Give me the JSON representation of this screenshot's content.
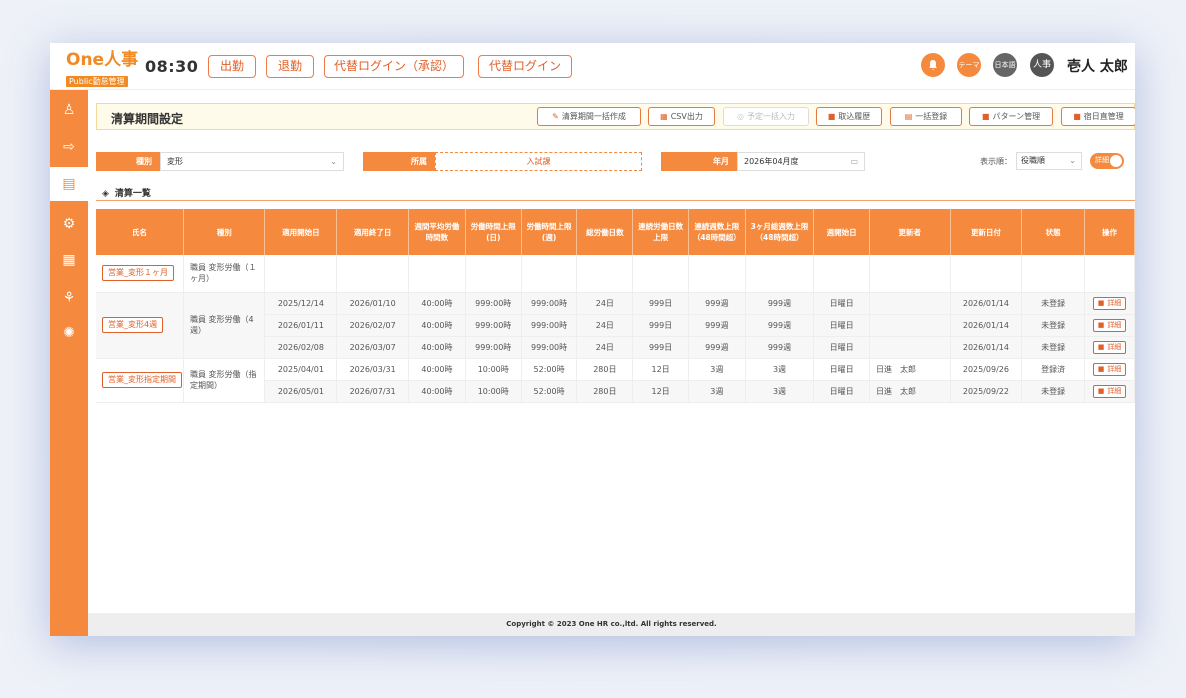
{
  "header": {
    "logo_main": "One人事",
    "logo_sub": "Public勤怠管理",
    "clock": "08:30",
    "buttons": [
      "出勤",
      "退勤",
      "代替ログイン（承認）",
      "代替ログイン"
    ],
    "bell_icon": "bell-icon",
    "theme_label": "テーマ",
    "lang_label": "日本語",
    "avatar_label": "人事",
    "user_name": "壱人 太郎",
    "accent_color": "#f58a3e"
  },
  "sidebar": {
    "icons": [
      "user-icon",
      "clock-in-icon",
      "document-icon",
      "settings-icon",
      "apps-icon",
      "network-icon",
      "atom-icon"
    ],
    "active_index": 2
  },
  "page": {
    "title": "清算期間設定",
    "toolbar": [
      {
        "icon": "✎",
        "label": "清算期間一括作成",
        "disabled": false
      },
      {
        "icon": "▦",
        "label": "CSV出力",
        "disabled": false
      },
      {
        "icon": "◎",
        "label": "予定一括入力",
        "disabled": true
      },
      {
        "icon": "■",
        "label": "取込履歴",
        "disabled": false
      },
      {
        "icon": "▤",
        "label": "一括登録",
        "disabled": false
      },
      {
        "icon": "■",
        "label": "パターン管理",
        "disabled": false
      },
      {
        "icon": "■",
        "label": "宿日直管理",
        "disabled": false
      }
    ]
  },
  "filters": {
    "type_label": "種別",
    "type_value": "変形",
    "dept_label": "所属",
    "dept_value": "入試課",
    "month_label": "年月",
    "month_value": "2026年04月度",
    "sort_label": "表示順：",
    "sort_value": "役職順",
    "toggle_label": "詳細"
  },
  "section": {
    "title": "清算一覧"
  },
  "table": {
    "headers": [
      "氏名",
      "種別",
      "適用開始日",
      "適用終了日",
      "週間平均労働時間数",
      "労働時間上限(日)",
      "労働時間上限(週)",
      "総労働日数",
      "連続労働日数上限",
      "連続週数上限（48時間超）",
      "3ヶ月総週数上限（48時間超）",
      "週開始日",
      "更新者",
      "更新日付",
      "状態",
      "操作"
    ],
    "groups": [
      {
        "name": "営業_変形１ヶ月",
        "type": "職員 変形労働（１ヶ月）",
        "rows": []
      },
      {
        "name": "営業_変形4週",
        "type": "職員 変形労働（4週）",
        "rows": [
          {
            "start": "2025/12/14",
            "end": "2026/01/10",
            "avg": "40:00時",
            "day": "999:00時",
            "week": "999:00時",
            "days": "24日",
            "consec": "999日",
            "w48": "999週",
            "m48": "999週",
            "wstart": "日曜日",
            "updater": "",
            "updated": "2026/01/14",
            "status": "未登録",
            "action": "詳細"
          },
          {
            "start": "2026/01/11",
            "end": "2026/02/07",
            "avg": "40:00時",
            "day": "999:00時",
            "week": "999:00時",
            "days": "24日",
            "consec": "999日",
            "w48": "999週",
            "m48": "999週",
            "wstart": "日曜日",
            "updater": "",
            "updated": "2026/01/14",
            "status": "未登録",
            "action": "詳細"
          },
          {
            "start": "2026/02/08",
            "end": "2026/03/07",
            "avg": "40:00時",
            "day": "999:00時",
            "week": "999:00時",
            "days": "24日",
            "consec": "999日",
            "w48": "999週",
            "m48": "999週",
            "wstart": "日曜日",
            "updater": "",
            "updated": "2026/01/14",
            "status": "未登録",
            "action": "詳細"
          }
        ]
      },
      {
        "name": "営業_変形指定期間",
        "type": "職員 変形労働（指定期間）",
        "rows": [
          {
            "start": "2025/04/01",
            "end": "2026/03/31",
            "avg": "40:00時",
            "day": "10:00時",
            "week": "52:00時",
            "days": "280日",
            "consec": "12日",
            "w48": "3週",
            "m48": "3週",
            "wstart": "日曜日",
            "updater": "日進　太郎",
            "updated": "2025/09/26",
            "status": "登録済",
            "action": "詳細"
          },
          {
            "start": "2026/05/01",
            "end": "2026/07/31",
            "avg": "40:00時",
            "day": "10:00時",
            "week": "52:00時",
            "days": "280日",
            "consec": "12日",
            "w48": "3週",
            "m48": "3週",
            "wstart": "日曜日",
            "updater": "日進　太郎",
            "updated": "2025/09/22",
            "status": "未登録",
            "action": "詳細"
          }
        ]
      }
    ]
  },
  "footer": {
    "copyright": "Copyright © 2023 One HR co.,ltd. All rights reserved."
  }
}
